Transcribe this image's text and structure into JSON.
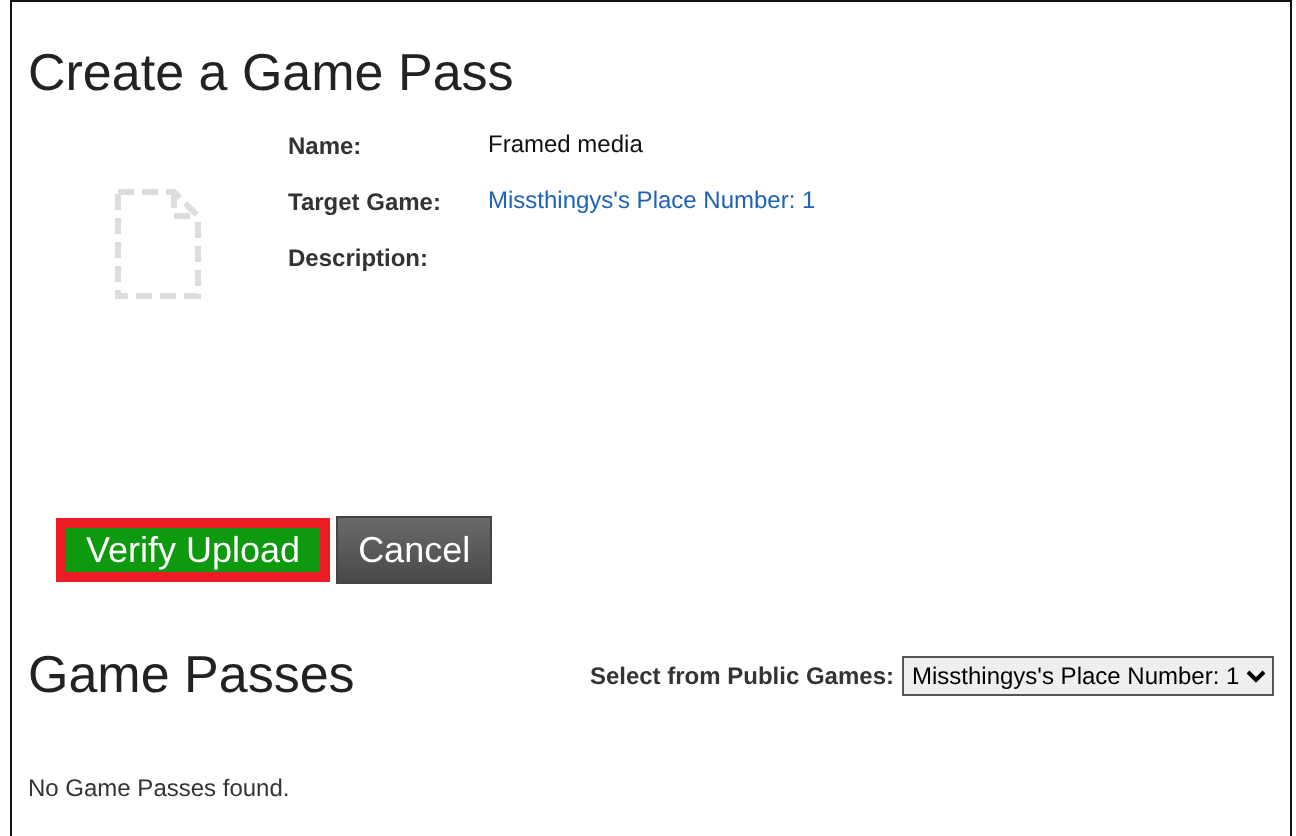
{
  "title": "Create a Game Pass",
  "fields": [
    {
      "label": "Name:",
      "value": "Framed media",
      "kind": "text"
    },
    {
      "label": "Target Game:",
      "value": "Missthingys's Place Number: 1",
      "kind": "link"
    },
    {
      "label": "Description:"
    }
  ],
  "buttons": [
    {
      "label": "Verify Upload",
      "kind": "primary",
      "highlighted": true
    },
    {
      "label": "Cancel",
      "kind": "secondary",
      "highlighted": false
    }
  ],
  "section_title": "Game Passes",
  "filter": {
    "label": "Select from Public Games:",
    "value": "Missthingys's Place Number: 1"
  },
  "empty_message": "No Game Passes found."
}
